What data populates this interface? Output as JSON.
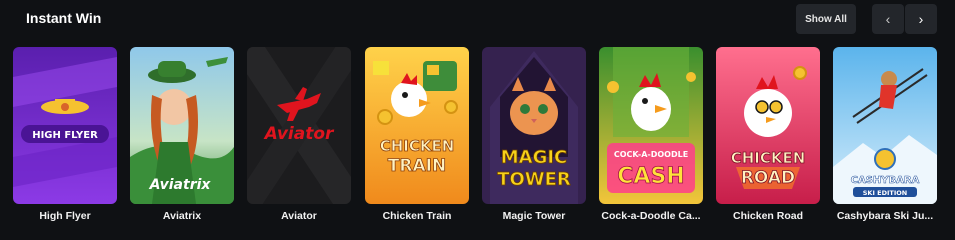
{
  "section": {
    "title": "Instant Win",
    "show_all_label": "Show All",
    "prev_icon": "chevron-left-icon",
    "next_icon": "chevron-right-icon",
    "prev_glyph": "‹",
    "next_glyph": "›"
  },
  "games": [
    {
      "name": "High Flyer",
      "logo": "HIGH FLYER",
      "accent": "#7b2fd6"
    },
    {
      "name": "Aviatrix",
      "logo": "Aviatrix",
      "accent": "#3aa14a"
    },
    {
      "name": "Aviator",
      "logo": "Aviator",
      "accent": "#e0141e"
    },
    {
      "name": "Chicken Train",
      "logo_line1": "CHICKEN",
      "logo_line2": "TRAIN",
      "accent": "#f5a623"
    },
    {
      "name": "Magic Tower",
      "logo_line1": "MAGIC",
      "logo_line2": "TOWER",
      "accent": "#f7d21a"
    },
    {
      "name": "Cock-a-Doodle Ca...",
      "logo_line1": "COCK-A-DOODLE",
      "logo_line2": "CASH",
      "accent": "#ff3d8b"
    },
    {
      "name": "Chicken Road",
      "logo_line1": "CHICKEN",
      "logo_line2": "ROAD",
      "accent": "#e8335a"
    },
    {
      "name": "Cashybara Ski Ju...",
      "logo_line1": "CASHYBARA",
      "logo_line2": "SKI EDITION",
      "accent": "#5bb4ec"
    }
  ]
}
